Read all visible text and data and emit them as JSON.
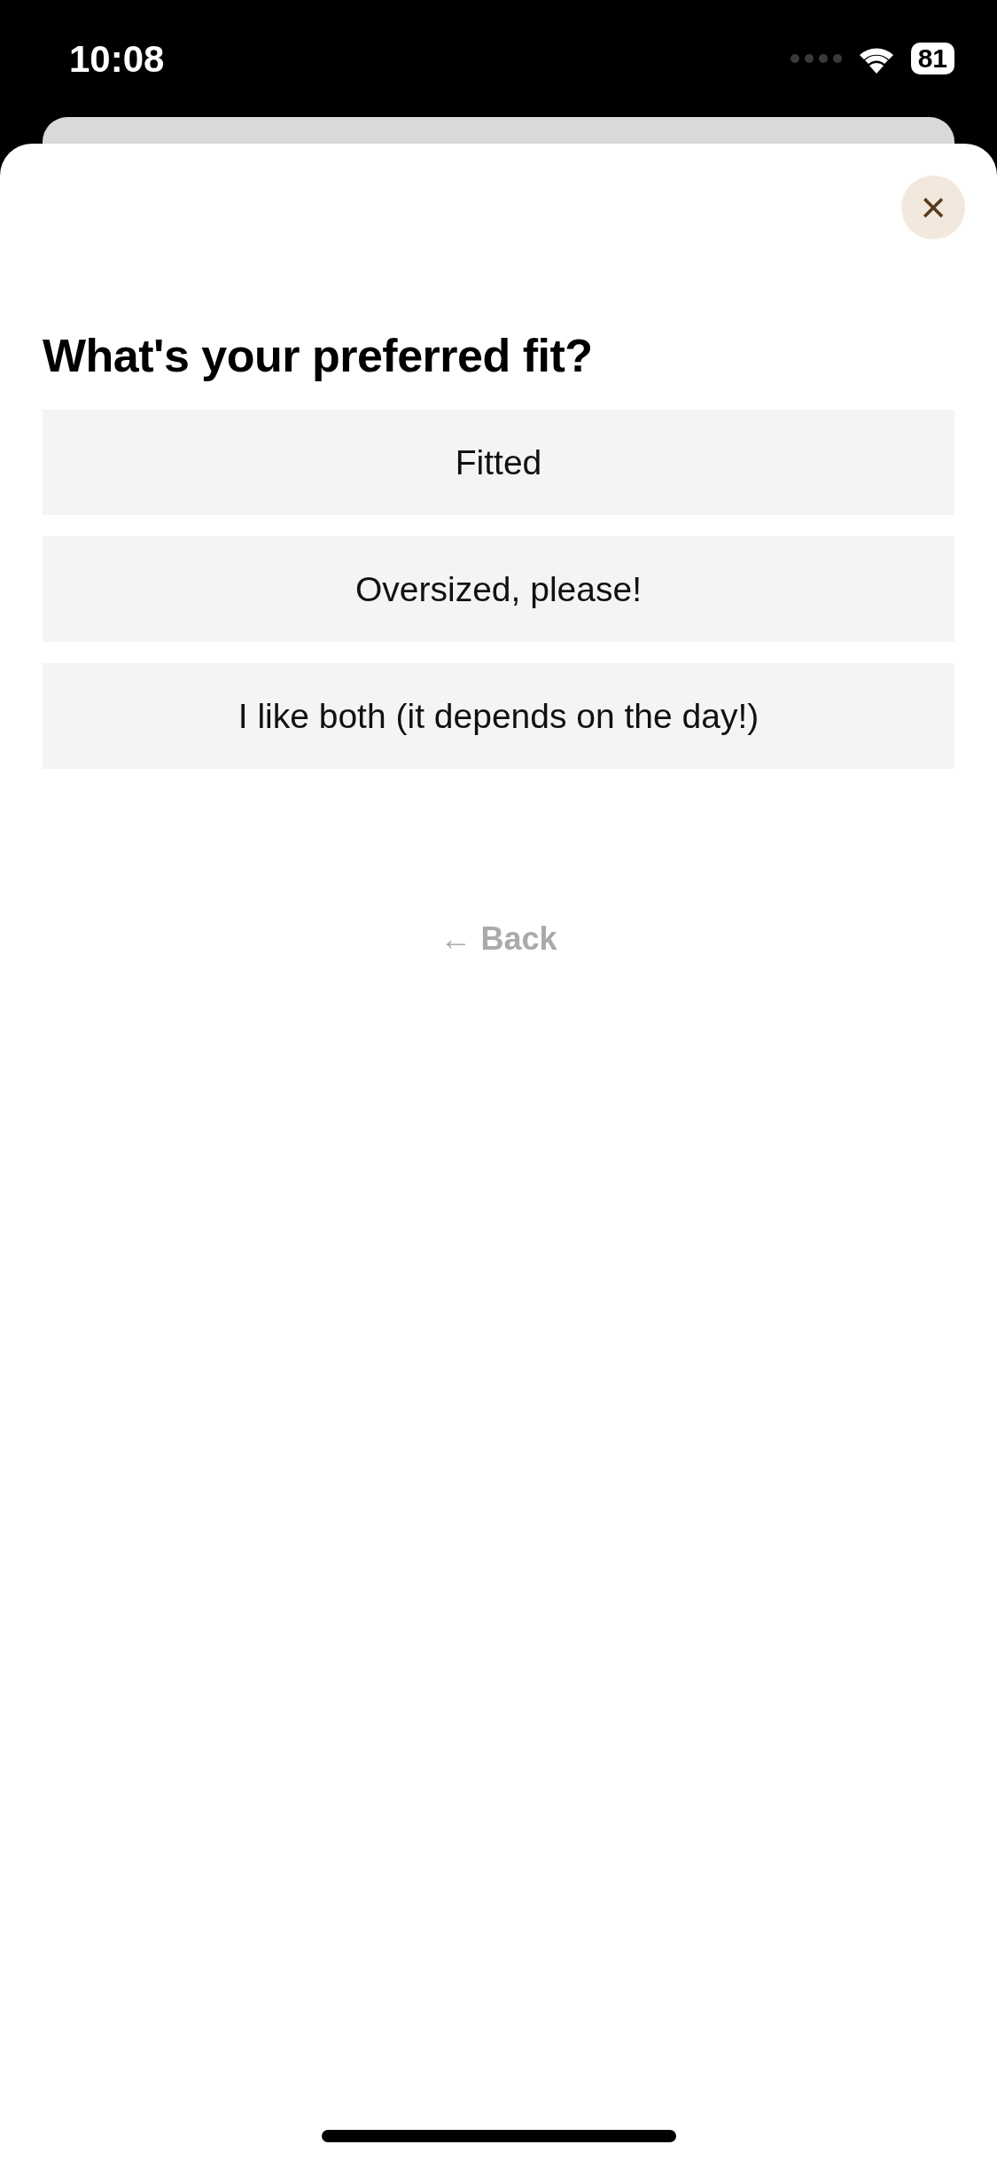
{
  "status_bar": {
    "time": "10:08",
    "battery": "81"
  },
  "sheet": {
    "close": "×",
    "title": "What's your preferred fit?",
    "options": [
      {
        "label": "Fitted"
      },
      {
        "label": "Oversized, please!"
      },
      {
        "label": "I like both (it depends on the day!)"
      }
    ],
    "back": {
      "arrow": "←",
      "label": "Back"
    }
  }
}
